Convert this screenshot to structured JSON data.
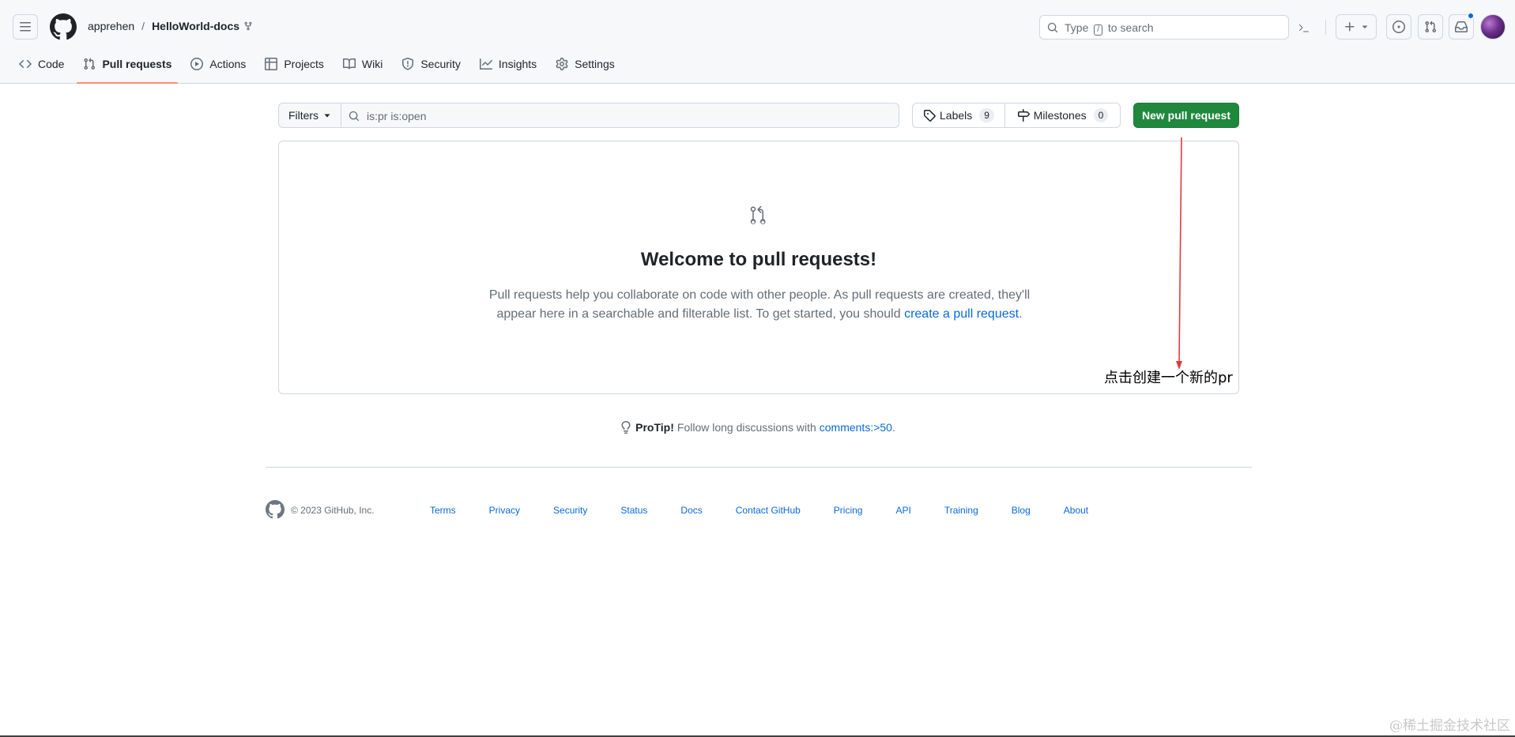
{
  "header": {
    "owner": "apprehen",
    "separator": "/",
    "repo": "HelloWorld-docs",
    "search_prefix": "Type",
    "search_key": "/",
    "search_suffix": "to search"
  },
  "nav": {
    "tabs": [
      {
        "label": "Code",
        "icon": "code-icon"
      },
      {
        "label": "Pull requests",
        "icon": "git-pull-request-icon",
        "selected": true
      },
      {
        "label": "Actions",
        "icon": "play-icon"
      },
      {
        "label": "Projects",
        "icon": "table-icon"
      },
      {
        "label": "Wiki",
        "icon": "book-icon"
      },
      {
        "label": "Security",
        "icon": "shield-icon"
      },
      {
        "label": "Insights",
        "icon": "graph-icon"
      },
      {
        "label": "Settings",
        "icon": "gear-icon"
      }
    ]
  },
  "toolbar": {
    "filters_label": "Filters",
    "filter_value": "is:pr is:open",
    "labels_label": "Labels",
    "labels_count": "9",
    "milestones_label": "Milestones",
    "milestones_count": "0",
    "new_pr_label": "New pull request"
  },
  "blankslate": {
    "title": "Welcome to pull requests!",
    "text_before": "Pull requests help you collaborate on code with other people. As pull requests are created, they'll appear here in a searchable and filterable list. To get started, you should ",
    "link": "create a pull request",
    "text_after": "."
  },
  "annotation": {
    "text": "点击创建一个新的pr",
    "color": "#e5383b"
  },
  "protip": {
    "strong": "ProTip!",
    "text": "Follow long discussions with",
    "link": "comments:>50",
    "after": "."
  },
  "footer": {
    "copyright": "© 2023 GitHub, Inc.",
    "links": [
      "Terms",
      "Privacy",
      "Security",
      "Status",
      "Docs",
      "Contact GitHub",
      "Pricing",
      "API",
      "Training",
      "Blog",
      "About"
    ]
  },
  "watermark": "@稀土掘金技术社区",
  "colors": {
    "primary_button": "#1f883d",
    "link": "#0969da",
    "selected_tab_underline": "#fd8c73"
  }
}
